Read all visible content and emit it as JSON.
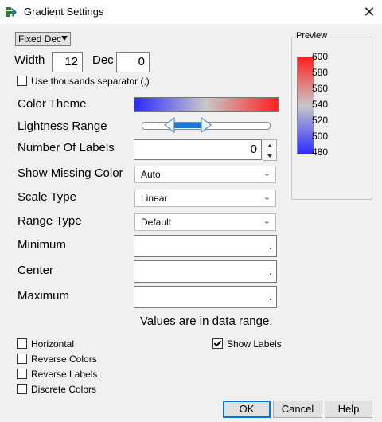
{
  "window": {
    "title": "Gradient Settings",
    "close_glyph": "✕"
  },
  "format": {
    "selected": "Fixed Dec"
  },
  "width": {
    "label": "Width",
    "value": "12"
  },
  "dec": {
    "label": "Dec",
    "value": "0"
  },
  "thousands": {
    "label": "Use thousands separator (,)",
    "checked": false
  },
  "color_theme": {
    "label": "Color Theme"
  },
  "lightness": {
    "label": "Lightness Range"
  },
  "num_labels": {
    "label": "Number Of Labels",
    "value": "0"
  },
  "missing_color": {
    "label": "Show Missing Color",
    "value": "Auto"
  },
  "scale_type": {
    "label": "Scale Type",
    "value": "Linear"
  },
  "range_type": {
    "label": "Range Type",
    "value": "Default"
  },
  "minimum": {
    "label": "Minimum",
    "value": "."
  },
  "center": {
    "label": "Center",
    "value": "."
  },
  "maximum": {
    "label": "Maximum",
    "value": "."
  },
  "range_note": "Values are in data range.",
  "checkboxes": {
    "horizontal": {
      "label": "Horizontal",
      "checked": false
    },
    "reverse_colors": {
      "label": "Reverse Colors",
      "checked": false
    },
    "reverse_labels": {
      "label": "Reverse Labels",
      "checked": false
    },
    "discrete_colors": {
      "label": "Discrete Colors",
      "checked": false
    },
    "show_labels": {
      "label": "Show Labels",
      "checked": true
    }
  },
  "preview": {
    "title": "Preview",
    "ticks": [
      "600",
      "580",
      "560",
      "540",
      "520",
      "500",
      "480"
    ]
  },
  "buttons": {
    "ok": "OK",
    "cancel": "Cancel",
    "help": "Help"
  },
  "colors": {
    "low": "#2b2bff",
    "mid": "#c8c8c8",
    "high": "#ff2020",
    "slider": "#1e78d2"
  }
}
